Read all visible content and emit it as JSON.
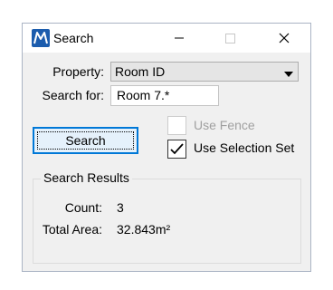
{
  "window": {
    "title": "Search",
    "app_icon": "microstation-m-icon",
    "controls": {
      "minimize": "minimize-icon",
      "maximize": "maximize-icon",
      "close": "close-icon"
    }
  },
  "form": {
    "property_label": "Property:",
    "property_value": "Room ID",
    "search_for_label": "Search for:",
    "search_for_value": "Room 7.*",
    "search_button": "Search",
    "use_fence_label": "Use Fence",
    "use_fence_checked": false,
    "use_fence_enabled": false,
    "use_selection_set_label": "Use Selection Set",
    "use_selection_set_checked": true
  },
  "results": {
    "group_label": "Search Results",
    "count_label": "Count:",
    "count_value": "3",
    "area_label": "Total Area:",
    "area_value": "32.843m²"
  },
  "colors": {
    "accent": "#0078d7",
    "app_icon_bg": "#1b5cad",
    "disabled_text": "#a0a0a0"
  }
}
